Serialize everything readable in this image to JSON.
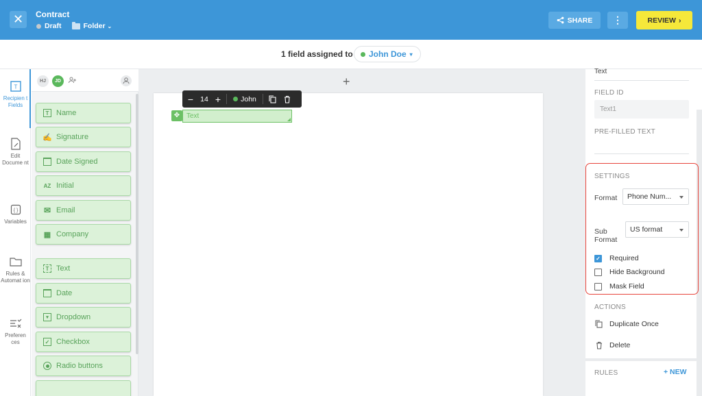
{
  "header": {
    "title": "Contract",
    "status": "Draft",
    "folder": "Folder",
    "share_label": "SHARE",
    "review_label": "REVIEW"
  },
  "assignment": {
    "text": "1 field assigned to",
    "assignee": "John Doe"
  },
  "rail": {
    "items": [
      {
        "label": "Recipien t Fields",
        "icon": "recipient-fields-icon",
        "active": true
      },
      {
        "label": "Edit Docume nt",
        "icon": "edit-document-icon",
        "active": false
      },
      {
        "label": "Variables",
        "icon": "variables-icon",
        "active": false
      },
      {
        "label": "Rules & Automat ion",
        "icon": "rules-icon",
        "active": false
      },
      {
        "label": "Preferen ces",
        "icon": "preferences-icon",
        "active": false
      }
    ]
  },
  "palette": {
    "avatars": [
      "HJ",
      "JD"
    ],
    "fields": [
      {
        "label": "Name",
        "icon": "name-icon"
      },
      {
        "label": "Signature",
        "icon": "signature-icon"
      },
      {
        "label": "Date Signed",
        "icon": "date-signed-icon"
      },
      {
        "label": "Initial",
        "icon": "initial-icon"
      },
      {
        "label": "Email",
        "icon": "email-icon"
      },
      {
        "label": "Company",
        "icon": "company-icon"
      },
      {
        "label": "Text",
        "icon": "text-icon"
      },
      {
        "label": "Date",
        "icon": "date-icon"
      },
      {
        "label": "Dropdown",
        "icon": "dropdown-icon"
      },
      {
        "label": "Checkbox",
        "icon": "checkbox-icon"
      },
      {
        "label": "Radio buttons",
        "icon": "radio-icon"
      }
    ]
  },
  "toolbar": {
    "font_size": "14",
    "assignee": "John"
  },
  "placed_field": {
    "label": "Text"
  },
  "properties": {
    "field_type": "Text",
    "field_id_label": "FIELD ID",
    "field_id_value": "Text1",
    "prefilled_label": "PRE-FILLED TEXT",
    "settings_label": "SETTINGS",
    "format_label": "Format",
    "format_value": "Phone Num...",
    "subformat_label_1": "Sub",
    "subformat_label_2": "Format",
    "subformat_value": "US format",
    "checkboxes": [
      {
        "label": "Required",
        "checked": true
      },
      {
        "label": "Hide Background",
        "checked": false
      },
      {
        "label": "Mask Field",
        "checked": false
      }
    ],
    "actions_label": "ACTIONS",
    "duplicate_label": "Duplicate Once",
    "delete_label": "Delete",
    "rules_label": "RULES",
    "new_label": "+ NEW"
  },
  "colors": {
    "header_blue": "#3d96d8",
    "review_yellow": "#f6e83a",
    "field_green": "#dcf2d9",
    "highlight_red": "#e8453c"
  }
}
